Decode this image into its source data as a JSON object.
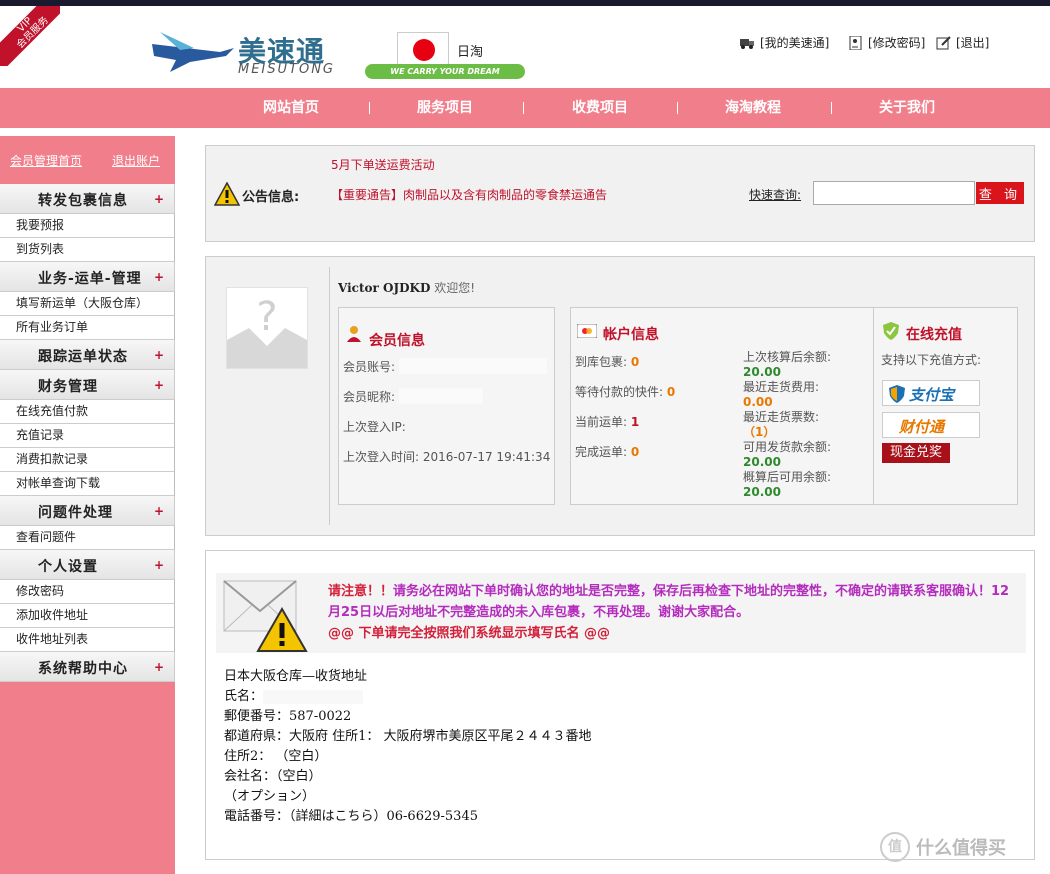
{
  "vip_badge": "VIP\n会员服务",
  "logo": {
    "cn": "美速通",
    "en": "MEISUTONG",
    "slogan": "WE CARRY YOUR DREAM"
  },
  "region": {
    "label": "日淘"
  },
  "toplinks": [
    {
      "label": "[我的美速通]"
    },
    {
      "label": "[修改密码]"
    },
    {
      "label": "[退出]"
    }
  ],
  "nav": [
    "网站首页",
    "服务项目",
    "收费项目",
    "海淘教程",
    "关于我们"
  ],
  "sidebar": {
    "home_link": "会员管理首页",
    "logout_link": "退出账户",
    "groups": [
      {
        "title": "转发包裹信息",
        "items": [
          "我要预报",
          "到货列表"
        ]
      },
      {
        "title": "业务-运单-管理",
        "items": [
          "填写新运单（大阪仓库）",
          "所有业务订单"
        ]
      },
      {
        "title": "跟踪运单状态",
        "items": []
      },
      {
        "title": "财务管理",
        "items": [
          "在线充值付款",
          "充值记录",
          "消费扣款记录",
          "对帐单查询下载"
        ]
      },
      {
        "title": "问题件处理",
        "items": [
          "查看问题件"
        ]
      },
      {
        "title": "个人设置",
        "items": [
          "修改密码",
          "添加收件地址",
          "收件地址列表"
        ]
      },
      {
        "title": "系统帮助中心",
        "items": []
      }
    ],
    "plus": "+"
  },
  "notice": {
    "label": "公告信息:",
    "line1": "5月下单送运费活动",
    "line2": "【重要通告】肉制品以及含有肉制品的零食禁运通告",
    "quick_label": "快速查询:",
    "search_value": "",
    "search_button": "查 询"
  },
  "member": {
    "welcome_name": "Victor OJDKD",
    "welcome_suffix": " 欢迎您!",
    "info_title": "会员信息",
    "account_label": "会员账号:",
    "nickname_label": "会员昵称:",
    "last_ip_label": "上次登入IP:",
    "last_time_label": "上次登入时间:",
    "last_time_value": "2016-07-17 19:41:34"
  },
  "account": {
    "title": "帐户信息",
    "left": [
      {
        "label": "到库包裹:",
        "value": "0"
      },
      {
        "label": "等待付款的快件:",
        "value": "0"
      },
      {
        "label": "当前运单:",
        "value": "1"
      },
      {
        "label": "完成运单:",
        "value": "0"
      }
    ],
    "right": [
      {
        "label": "上次核算后余额:",
        "value": "20.00",
        "tone": "green"
      },
      {
        "label": "最近走货费用:",
        "value": "0.00",
        "tone": "orange"
      },
      {
        "label": "最近走货票数:",
        "value": "（1）",
        "tone": "orange"
      },
      {
        "label": "可用发货款余额:",
        "value": "20.00",
        "tone": "green"
      },
      {
        "label": "概算后可用余额:",
        "value": "20.00",
        "tone": "green"
      }
    ]
  },
  "recharge": {
    "title": "在线充值",
    "desc": "支持以下充值方式:",
    "alipay": "支付宝",
    "caifutong": "财付通",
    "cash": "现金兑奖"
  },
  "alert": {
    "line1_a": "请注意！！",
    "line1_b": "请务必在网站下单时确认您的地址是否完整，保存后再检查下地址的完整性，不确定的请联系客服确认！12月25日以后对地址不完整造成的未入库包裹，不再处理。谢谢大家配合。",
    "line2": "@@ 下单请完全按照我们系统显示填写氏名 @@"
  },
  "address": {
    "title": "日本大阪仓库—收货地址",
    "name_label": "氏名：",
    "postal": "郵便番号：587-0022",
    "pref": "都道府県：大阪府 住所1： 大阪府堺市美原区平尾２４４３番地",
    "addr2": "住所2： （空白）",
    "company": "会社名：（空白）",
    "option": "（オプション）",
    "phone": "電話番号：（詳細はこちら）06-6629-5345"
  },
  "watermark": {
    "circle": "值",
    "text": "什么值得买"
  }
}
